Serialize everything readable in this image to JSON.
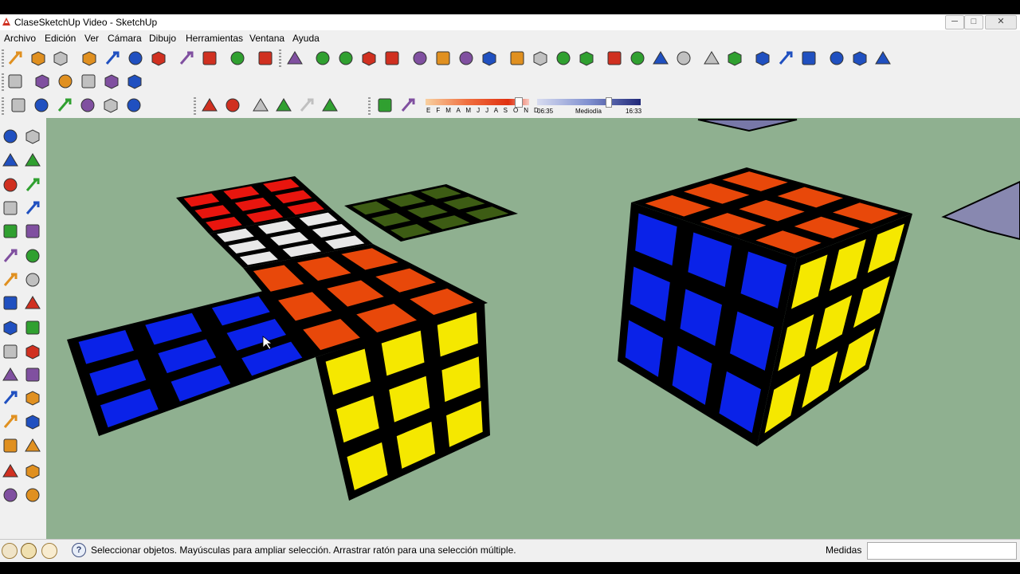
{
  "window": {
    "title": "ClaseSketchUp Video - SketchUp",
    "minimize": "─",
    "maximize": "□",
    "close": "✕"
  },
  "menu": [
    "Archivo",
    "Edición",
    "Ver",
    "Cámara",
    "Dibujo",
    "Herramientas",
    "Ventana",
    "Ayuda"
  ],
  "shadow_panel": {
    "months": "E F M A M J J A S O N D",
    "time_start": "06:35",
    "time_mid": "Mediodía",
    "time_end": "16:33"
  },
  "status": {
    "message": "Seleccionar objetos. Mayúsculas para ampliar selección. Arrastrar ratón para una selección múltiple.",
    "measure_label": "Medidas",
    "measure_value": ""
  },
  "colors": {
    "viewport_bg": "#8fb090",
    "red": "#e8150e",
    "white": "#e8e8e8",
    "green": "#3d5c14",
    "orange": "#e8480a",
    "blue": "#0a22e8",
    "yellow": "#f5e800"
  },
  "toolbar_row1": [
    "new-icon",
    "open-icon",
    "save-icon",
    "cut-icon",
    "copy-icon",
    "paste-icon",
    "erase-icon",
    "undo-icon",
    "redo-icon",
    "print-icon",
    "model-info-icon",
    "select-icon",
    "pencil-icon",
    "rectangle-icon",
    "circle-icon",
    "arc-icon",
    "make-component-icon",
    "eraser-icon",
    "tape-icon",
    "paint-bucket-icon",
    "push-pull-icon",
    "move-icon",
    "rotate-icon",
    "offset-icon",
    "orbit-icon",
    "pan-icon",
    "zoom-icon",
    "zoom-extents-icon",
    "previous-view-icon",
    "next-view-icon",
    "add-location-icon",
    "terrain-icon",
    "share-model-icon",
    "warehouse-icon",
    "component-share-icon",
    "extension-icon"
  ],
  "toolbar_row2": [
    "layer-icon",
    "section-plane-icon",
    "section-cut-icon",
    "display-sections-icon",
    "display-cuts-icon",
    "fill-icon"
  ],
  "toolbar_row3": [
    "iso-view-icon",
    "front-view-icon",
    "top-view-icon",
    "right-view-icon",
    "back-view-icon",
    "left-view-icon",
    "xray-icon",
    "wireframe-icon",
    "hidden-line-icon",
    "shaded-icon",
    "textured-icon",
    "monochrome-icon",
    "shadows-icon",
    "fog-icon"
  ],
  "side_tools": [
    "select-tool-icon",
    "make-component-tool-icon",
    "paint-tool-icon",
    "eraser-tool-icon",
    "rectangle-tool-icon",
    "line-tool-icon",
    "circle-tool-icon",
    "arc-tool-icon",
    "polygon-tool-icon",
    "freehand-tool-icon",
    "move-tool-icon",
    "push-pull-tool-icon",
    "rotate-tool-icon",
    "follow-me-tool-icon",
    "scale-tool-icon",
    "offset-tool-icon",
    "tape-tool-icon",
    "dimension-tool-icon",
    "protractor-tool-icon",
    "text-tool-icon",
    "axes-tool-icon",
    "3d-text-tool-icon",
    "orbit-tool-icon",
    "pan-tool-icon",
    "zoom-tool-icon",
    "zoom-window-tool-icon",
    "zoom-extents-tool-icon",
    "previous-tool-icon",
    "position-camera-tool-icon",
    "look-around-tool-icon",
    "walk-tool-icon",
    "section-tool-icon"
  ]
}
